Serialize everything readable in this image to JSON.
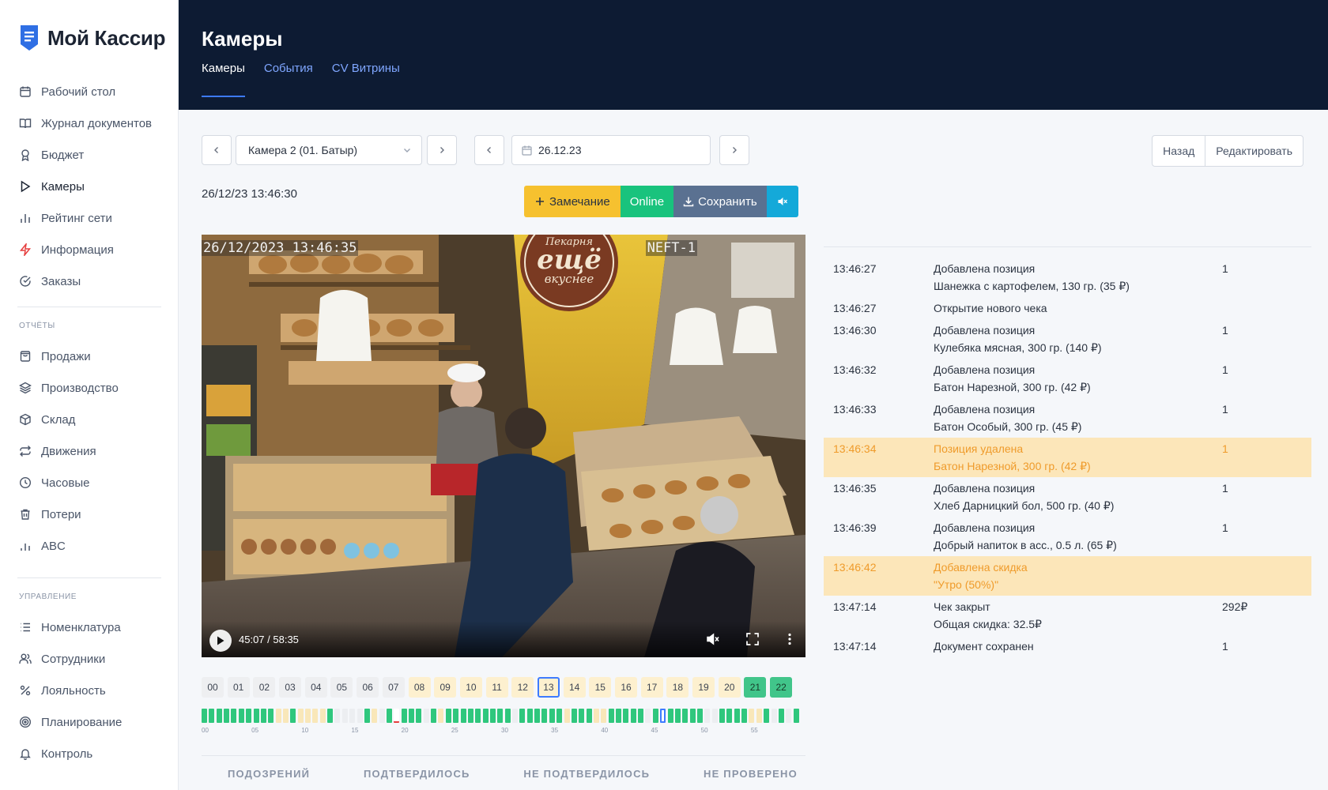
{
  "brand": {
    "name": "Мой Кассир"
  },
  "sidebar": {
    "items": [
      {
        "label": "Рабочий стол",
        "icon": "calendar-icon"
      },
      {
        "label": "Журнал документов",
        "icon": "book-icon"
      },
      {
        "label": "Бюджет",
        "icon": "award-icon"
      },
      {
        "label": "Камеры",
        "icon": "play-icon",
        "active": true
      },
      {
        "label": "Рейтинг сети",
        "icon": "bar-chart-icon"
      },
      {
        "label": "Информация",
        "icon": "zap-icon"
      },
      {
        "label": "Заказы",
        "icon": "check-circle-icon"
      }
    ],
    "reports_title": "ОТЧЁТЫ",
    "reports": [
      {
        "label": "Продажи",
        "icon": "receipt-icon"
      },
      {
        "label": "Производство",
        "icon": "layers-icon"
      },
      {
        "label": "Склад",
        "icon": "box-icon"
      },
      {
        "label": "Движения",
        "icon": "repeat-icon"
      },
      {
        "label": "Часовые",
        "icon": "clock-icon"
      },
      {
        "label": "Потери",
        "icon": "trash-icon"
      },
      {
        "label": "ABC",
        "icon": "bar-chart-icon"
      }
    ],
    "manage_title": "УПРАВЛЕНИЕ",
    "manage": [
      {
        "label": "Номенклатура",
        "icon": "list-icon"
      },
      {
        "label": "Сотрудники",
        "icon": "users-icon"
      },
      {
        "label": "Лояльность",
        "icon": "percent-icon"
      },
      {
        "label": "Планирование",
        "icon": "target-icon"
      },
      {
        "label": "Контроль",
        "icon": "bell-icon"
      }
    ]
  },
  "header": {
    "title": "Камеры",
    "tabs": [
      {
        "label": "Камеры",
        "active": true
      },
      {
        "label": "События"
      },
      {
        "label": "CV Витрины"
      }
    ]
  },
  "controls": {
    "camera_select": "Камера 2 (01. Батыр)",
    "date": "26.12.23",
    "back_label": "Назад",
    "edit_label": "Редактировать"
  },
  "player": {
    "timestamp": "26/12/23 13:46:30",
    "remark_label": "Замечание",
    "online_label": "Online",
    "save_label": "Сохранить",
    "osd_datetime": "26/12/2023 13:46:35",
    "osd_camera": "NEFT-1",
    "time_display": "45:07 / 58:35",
    "sign_line1": "Пекарня",
    "sign_line2": "ещё",
    "sign_line3": "вкуснее"
  },
  "hours": [
    {
      "label": "00",
      "state": "none"
    },
    {
      "label": "01",
      "state": "none"
    },
    {
      "label": "02",
      "state": "none"
    },
    {
      "label": "03",
      "state": "none"
    },
    {
      "label": "04",
      "state": "none"
    },
    {
      "label": "05",
      "state": "none"
    },
    {
      "label": "06",
      "state": "none"
    },
    {
      "label": "07",
      "state": "none"
    },
    {
      "label": "08",
      "state": "yellow"
    },
    {
      "label": "09",
      "state": "yellow"
    },
    {
      "label": "10",
      "state": "yellow"
    },
    {
      "label": "11",
      "state": "yellow"
    },
    {
      "label": "12",
      "state": "yellow"
    },
    {
      "label": "13",
      "state": "selected"
    },
    {
      "label": "14",
      "state": "yellow"
    },
    {
      "label": "15",
      "state": "yellow"
    },
    {
      "label": "16",
      "state": "yellow"
    },
    {
      "label": "17",
      "state": "yellow"
    },
    {
      "label": "18",
      "state": "yellow"
    },
    {
      "label": "19",
      "state": "yellow"
    },
    {
      "label": "20",
      "state": "yellow"
    },
    {
      "label": "21",
      "state": "green"
    },
    {
      "label": "22",
      "state": "green"
    }
  ],
  "minutes_states": "ggggggggggyygyyyygeeeegyegrgggegygggggggggeggggggygggyygggggegsgggggeeggggyygegeg",
  "minute_ticks": [
    "00",
    "05",
    "10",
    "15",
    "20",
    "25",
    "30",
    "35",
    "40",
    "45",
    "50",
    "55"
  ],
  "stats": [
    "ПОДОЗРЕНИЙ",
    "ПОДТВЕРДИЛОСЬ",
    "НЕ ПОДТВЕРДИЛОСЬ",
    "НЕ ПРОВЕРЕНО"
  ],
  "events": [
    {
      "time": "13:46:27",
      "lines": [
        "Добавлена позиция",
        "Шанежка с картофелем, 130 гр. (35 ₽)"
      ],
      "qty": "1"
    },
    {
      "time": "13:46:27",
      "lines": [
        "Открытие нового чека"
      ],
      "qty": ""
    },
    {
      "time": "13:46:30",
      "lines": [
        "Добавлена позиция",
        "Кулебяка мясная, 300 гр. (140 ₽)"
      ],
      "qty": "1"
    },
    {
      "time": "13:46:32",
      "lines": [
        "Добавлена позиция",
        "Батон Нарезной, 300 гр. (42 ₽)"
      ],
      "qty": "1"
    },
    {
      "time": "13:46:33",
      "lines": [
        "Добавлена позиция",
        "Батон Особый, 300 гр. (45 ₽)"
      ],
      "qty": "1"
    },
    {
      "time": "13:46:34",
      "lines": [
        "Позиция удалена",
        "Батон Нарезной, 300 гр. (42 ₽)"
      ],
      "qty": "1",
      "highlight": true
    },
    {
      "time": "13:46:35",
      "lines": [
        "Добавлена позиция",
        "Хлеб Дарницкий бол, 500 гр. (40 ₽)"
      ],
      "qty": "1"
    },
    {
      "time": "13:46:39",
      "lines": [
        "Добавлена позиция",
        "Добрый напиток в асс., 0.5 л. (65 ₽)"
      ],
      "qty": "1"
    },
    {
      "time": "13:46:42",
      "lines": [
        "Добавлена скидка",
        "\"Утро (50%)\""
      ],
      "qty": "",
      "highlight": true
    },
    {
      "time": "13:47:14",
      "lines": [
        "Чек закрыт",
        "Общая скидка: 32.5₽"
      ],
      "qty": "292₽"
    },
    {
      "time": "13:47:14",
      "lines": [
        "Документ сохранен"
      ],
      "qty": "1"
    }
  ],
  "colors": {
    "header_bg": "#0d1b33",
    "accent_blue": "#3d7bff",
    "warn": "#f6c12f",
    "online": "#19c37d",
    "save": "#5a7191",
    "mute": "#14a9d9",
    "highlight_row": "#fce6b9"
  }
}
